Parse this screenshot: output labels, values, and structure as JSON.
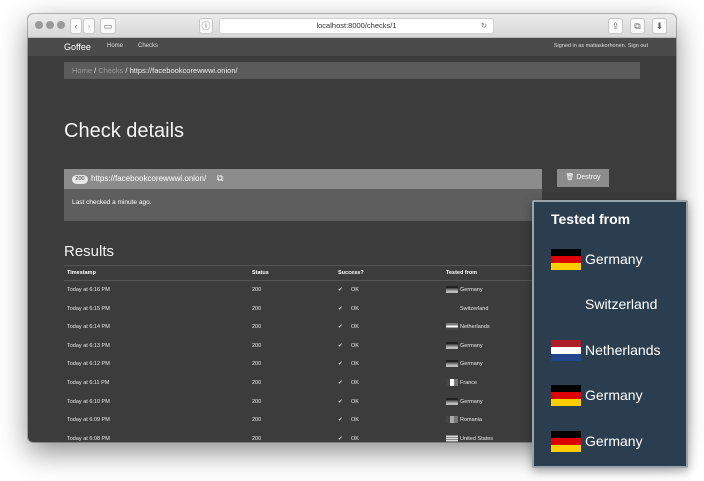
{
  "browser": {
    "url": "localhost:8000/checks/1"
  },
  "navbar": {
    "brand": "Goffee",
    "links": [
      "Home",
      "Checks"
    ],
    "signed_in": "Signed in as matiaskorhonen.",
    "sign_out": "Sign out"
  },
  "breadcrumb": {
    "home": "Home",
    "checks": "Checks",
    "current": "https://facebookcorewwwi.onion/",
    "separator": "/"
  },
  "page_title": "Check details",
  "check": {
    "status_badge": "200",
    "url": "https://facebookcorewwwi.onion/",
    "last_checked": "Last checked a minute ago."
  },
  "destroy_label": "Destroy",
  "results": {
    "title": "Results",
    "columns": [
      "Timestamp",
      "Status",
      "Success?",
      "Tested from"
    ],
    "rows": [
      {
        "timestamp": "Today at 6:16 PM",
        "status": "200",
        "success": "OK",
        "country": "Germany",
        "flag": "gray-de"
      },
      {
        "timestamp": "Today at 6:15 PM",
        "status": "200",
        "success": "OK",
        "country": "Switzerland",
        "flag": "gray-ch"
      },
      {
        "timestamp": "Today at 6:14 PM",
        "status": "200",
        "success": "OK",
        "country": "Netherlands",
        "flag": "gray-nl"
      },
      {
        "timestamp": "Today at 6:13 PM",
        "status": "200",
        "success": "OK",
        "country": "Germany",
        "flag": "gray-de"
      },
      {
        "timestamp": "Today at 6:12 PM",
        "status": "200",
        "success": "OK",
        "country": "Germany",
        "flag": "gray-de"
      },
      {
        "timestamp": "Today at 6:11 PM",
        "status": "200",
        "success": "OK",
        "country": "France",
        "flag": "gray-fr"
      },
      {
        "timestamp": "Today at 6:10 PM",
        "status": "200",
        "success": "OK",
        "country": "Germany",
        "flag": "gray-de"
      },
      {
        "timestamp": "Today at 6:09 PM",
        "status": "200",
        "success": "OK",
        "country": "Romania",
        "flag": "gray-ro"
      },
      {
        "timestamp": "Today at 6:08 PM",
        "status": "200",
        "success": "OK",
        "country": "United States",
        "flag": "gray-us"
      }
    ]
  },
  "overlay": {
    "title": "Tested from",
    "items": [
      {
        "country": "Germany",
        "flag": "de"
      },
      {
        "country": "Switzerland",
        "flag": "ch"
      },
      {
        "country": "Netherlands",
        "flag": "nl"
      },
      {
        "country": "Germany",
        "flag": "de"
      },
      {
        "country": "Germany",
        "flag": "de"
      }
    ]
  },
  "icons": {
    "check": "✔",
    "trash": "🗑",
    "external_link": "⧉"
  }
}
